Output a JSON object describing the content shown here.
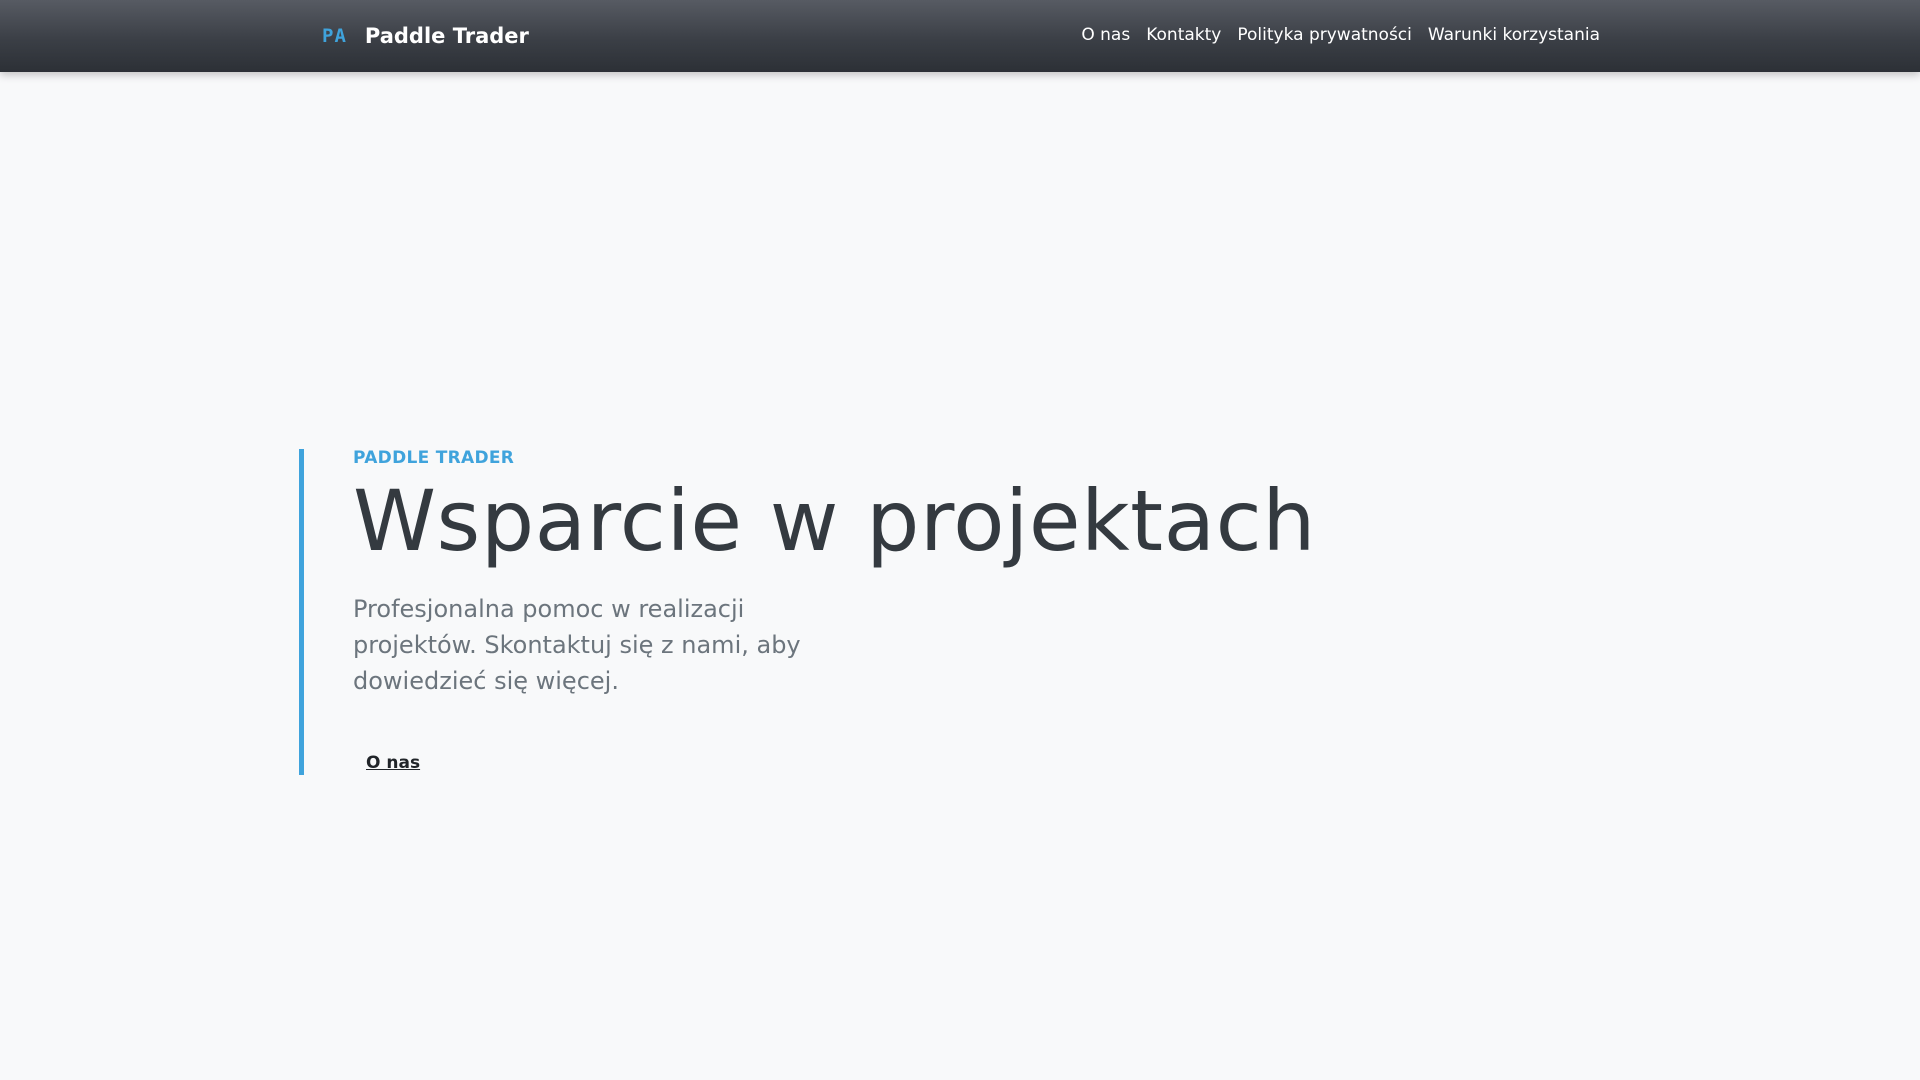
{
  "brand": {
    "abbr": "PA",
    "name": "Paddle Trader"
  },
  "nav": {
    "items": [
      {
        "label": "O nas"
      },
      {
        "label": "Kontakty"
      },
      {
        "label": "Polityka prywatności"
      },
      {
        "label": "Warunki korzystania"
      }
    ]
  },
  "hero": {
    "eyebrow": "PADDLE TRADER",
    "headline": "Wsparcie w projektach",
    "lead": "Profesjonalna pomoc w realizacji projektów. Skontaktuj się z nami, aby dowiedzieć się więcej.",
    "cta_label": "O nas"
  },
  "colors": {
    "accent": "#3fa3dc",
    "navbar": "#3b3f46",
    "background": "#f8f9fa",
    "headline": "#343a40",
    "lead": "#6c757d"
  }
}
